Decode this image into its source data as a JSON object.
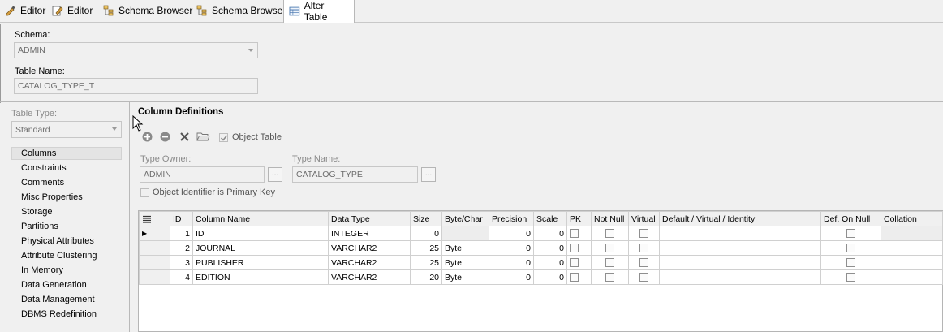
{
  "tabs": [
    {
      "label": "Editor",
      "icon": "editor-icon"
    },
    {
      "label": "Editor",
      "icon": "editor-icon"
    },
    {
      "label": "Schema Browser",
      "icon": "schema-browser-icon"
    },
    {
      "label": "Schema Browser",
      "icon": "schema-browser-icon"
    },
    {
      "label": "Alter Table",
      "icon": "alter-table-icon",
      "active": true
    }
  ],
  "form": {
    "schema_label": "Schema:",
    "schema_value": "ADMIN",
    "table_name_label": "Table Name:",
    "table_name_value": "CATALOG_TYPE_T",
    "table_type_label": "Table Type:",
    "table_type_value": "Standard"
  },
  "nav": {
    "selected": "Columns",
    "items": [
      "Columns",
      "Constraints",
      "Comments",
      "Misc Properties",
      "Storage",
      "Partitions",
      "Physical Attributes",
      "Attribute Clustering",
      "In Memory",
      "Data Generation",
      "Data Management",
      "DBMS Redefinition"
    ]
  },
  "columns_panel": {
    "title": "Column Definitions",
    "object_table_label": "Object Table",
    "object_table_checked": true,
    "type_owner_label": "Type Owner:",
    "type_owner_value": "ADMIN",
    "type_name_label": "Type Name:",
    "type_name_value": "CATALOG_TYPE",
    "ellipsis": "...",
    "oid_pk_label": "Object Identifier is Primary Key",
    "oid_pk_checked": false
  },
  "grid": {
    "headers": [
      "ID",
      "Column Name",
      "Data Type",
      "Size",
      "Byte/Char",
      "Precision",
      "Scale",
      "PK",
      "Not Null",
      "Virtual",
      "Default / Virtual / Identity",
      "Def. On Null",
      "Collation"
    ],
    "current_row_marker": "▶",
    "rows": [
      {
        "id": "1",
        "name": "ID",
        "type": "INTEGER",
        "size": "0",
        "bytechar": "",
        "precision": "0",
        "scale": "0"
      },
      {
        "id": "2",
        "name": "JOURNAL",
        "type": "VARCHAR2",
        "size": "25",
        "bytechar": "Byte",
        "precision": "0",
        "scale": "0"
      },
      {
        "id": "3",
        "name": "PUBLISHER",
        "type": "VARCHAR2",
        "size": "25",
        "bytechar": "Byte",
        "precision": "0",
        "scale": "0"
      },
      {
        "id": "4",
        "name": "EDITION",
        "type": "VARCHAR2",
        "size": "20",
        "bytechar": "Byte",
        "precision": "0",
        "scale": "0"
      }
    ]
  }
}
